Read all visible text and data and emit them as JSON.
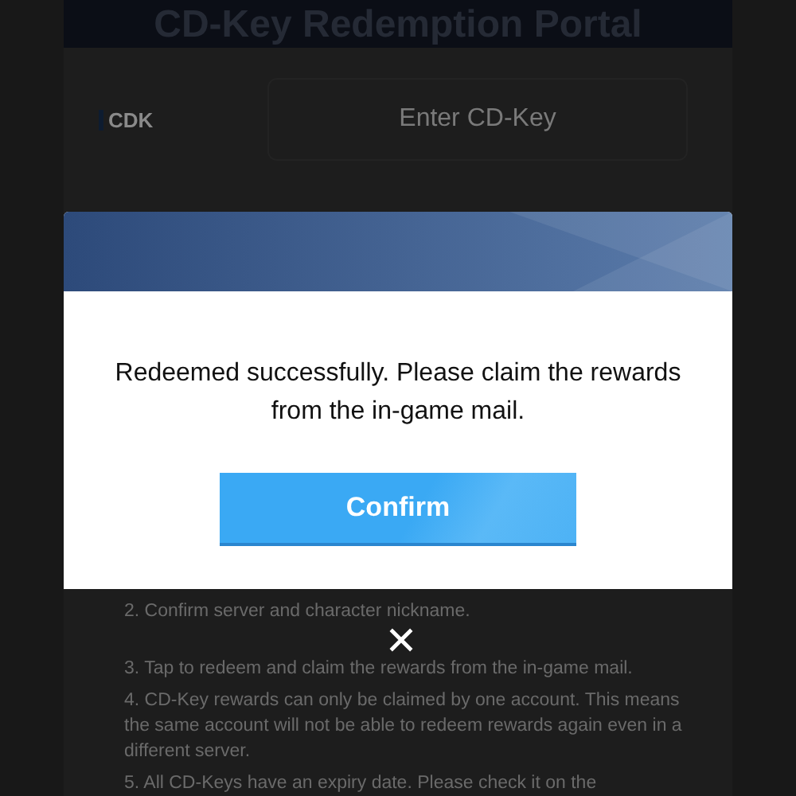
{
  "portal": {
    "title": "CD-Key Redemption Portal"
  },
  "form": {
    "label": "CDK",
    "placeholder": "Enter CD-Key"
  },
  "instructions": [
    "2. Confirm server and character nickname.",
    "3. Tap to redeem and claim the rewards from the in-game mail.",
    "4. CD-Key rewards can only be claimed by one account. This means the same account will not be able to redeem rewards again even in a different server.",
    "5. All CD-Keys have an expiry date. Please check it on the"
  ],
  "dialog": {
    "message": "Redeemed successfully. Please claim the rewards from the in-game mail.",
    "button": "Confirm"
  }
}
